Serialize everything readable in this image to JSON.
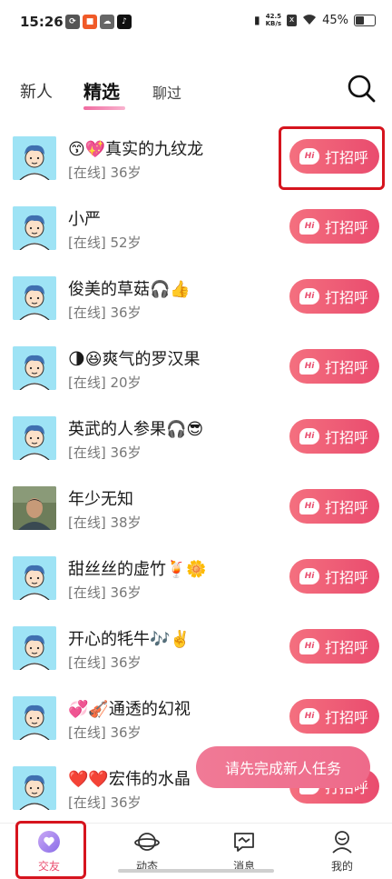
{
  "status_bar": {
    "time": "15:26",
    "net_speed_top": "42.5",
    "net_speed_bottom": "KB/s",
    "battery": "45%",
    "app_icons": [
      "sync-icon",
      "notification-app-icon",
      "cloud-icon",
      "tiktok-icon"
    ]
  },
  "tabs": [
    {
      "label": "新人"
    },
    {
      "label": "精选"
    },
    {
      "label": "聊过"
    }
  ],
  "users": [
    {
      "name": "😙💖真实的九纹龙",
      "status": "[在线] 36岁"
    },
    {
      "name": "小严",
      "status": "[在线] 52岁"
    },
    {
      "name": "俊美的草菇🎧👍",
      "status": "[在线] 36岁"
    },
    {
      "name": "🌗😆爽气的罗汉果",
      "status": "[在线] 20岁"
    },
    {
      "name": "英武的人参果🎧😎",
      "status": "[在线] 36岁"
    },
    {
      "name": "年少无知",
      "status": "[在线] 38岁"
    },
    {
      "name": "甜丝丝的虚竹🍹🌼",
      "status": "[在线] 36岁"
    },
    {
      "name": "开心的牦牛🎶✌️",
      "status": "[在线] 36岁"
    },
    {
      "name": "💞🎻通透的幻视",
      "status": "[在线] 36岁"
    },
    {
      "name": "❤️❤️宏伟的水晶",
      "status": "[在线] 36岁"
    }
  ],
  "greet_button": {
    "badge": "Hi",
    "label": "打招呼"
  },
  "toast": "请先完成新人任务",
  "bottom_nav": [
    {
      "label": "交友"
    },
    {
      "label": "动态"
    },
    {
      "label": "消息"
    },
    {
      "label": "我的"
    }
  ],
  "colors": {
    "accent": "#ea4f70",
    "highlight_box": "#d6141e",
    "avatar_bg": "#9ee3f5"
  }
}
